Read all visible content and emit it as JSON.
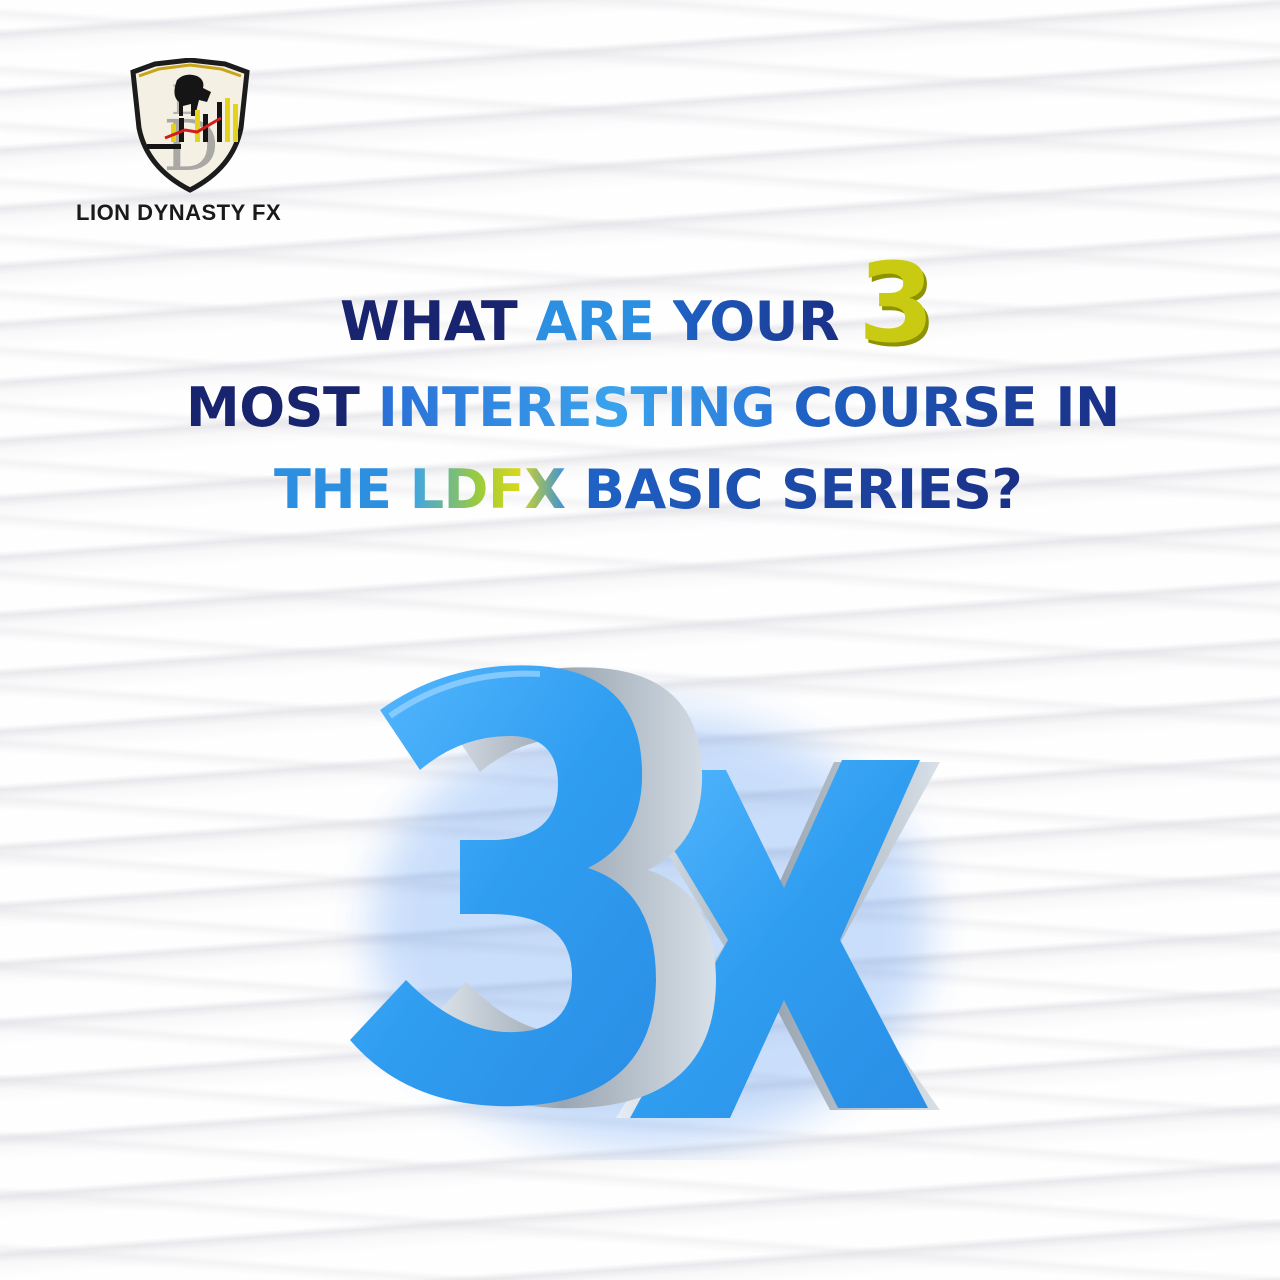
{
  "brand": {
    "name_part1": "LI",
    "name_part2": "ON DYNASTY F",
    "name_part3": "X"
  },
  "headline": {
    "line1_word1": "WHAT",
    "line1_word2": "ARE",
    "line1_word3": "YOUR",
    "number": "3",
    "line2_word1": "MOST",
    "line2_word2": "INTERESTING",
    "line2_word3": "COURSE IN",
    "line3_word1": "THE",
    "line3_word2": "LDFX",
    "line3_word3": "BASIC SERIES?"
  },
  "graphic": {
    "label": "3X"
  },
  "colors": {
    "navy": "#18246e",
    "blue": "#2d8fe0",
    "yellow": "#c8cb12",
    "graphic_blue": "#2f9df0"
  }
}
